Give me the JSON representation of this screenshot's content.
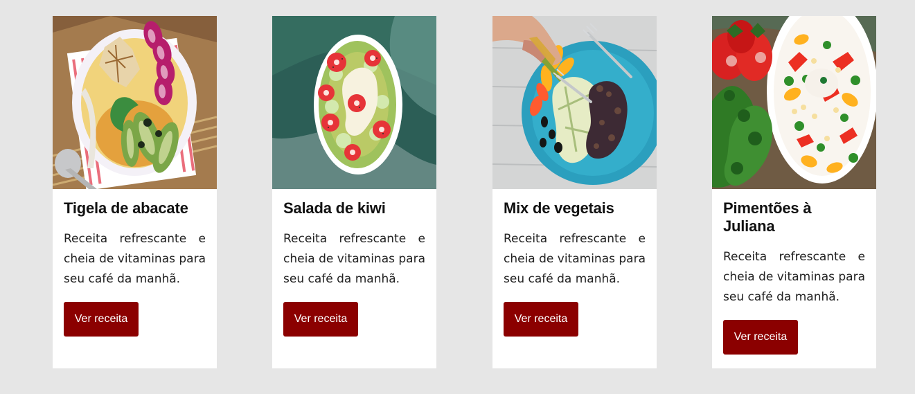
{
  "cards": [
    {
      "image_name": "avocado-bowl-image",
      "title": "Tigela de abacate",
      "description": "Receita refrescante e cheia de vitaminas para seu café da manhã.",
      "button_label": "Ver receita"
    },
    {
      "image_name": "kiwi-salad-image",
      "title": "Salada de kiwi",
      "description": "Receita refrescante e cheia de vitaminas para seu café da manhã.",
      "button_label": "Ver receita"
    },
    {
      "image_name": "vegetable-mix-image",
      "title": "Mix de vegetais",
      "description": "Receita refrescante e cheia de vitaminas para seu café da manhã.",
      "button_label": "Ver receita"
    },
    {
      "image_name": "julienne-peppers-image",
      "title": "Pimentões à Juliana",
      "description": "Receita refrescante e cheia de vitaminas para seu café da manhã.",
      "button_label": "Ver receita"
    }
  ],
  "colors": {
    "page_background": "#e6e6e6",
    "card_background": "#ffffff",
    "button_background": "#8b0000",
    "button_text": "#ffffff",
    "title_text": "#111111",
    "body_text": "#222222"
  }
}
